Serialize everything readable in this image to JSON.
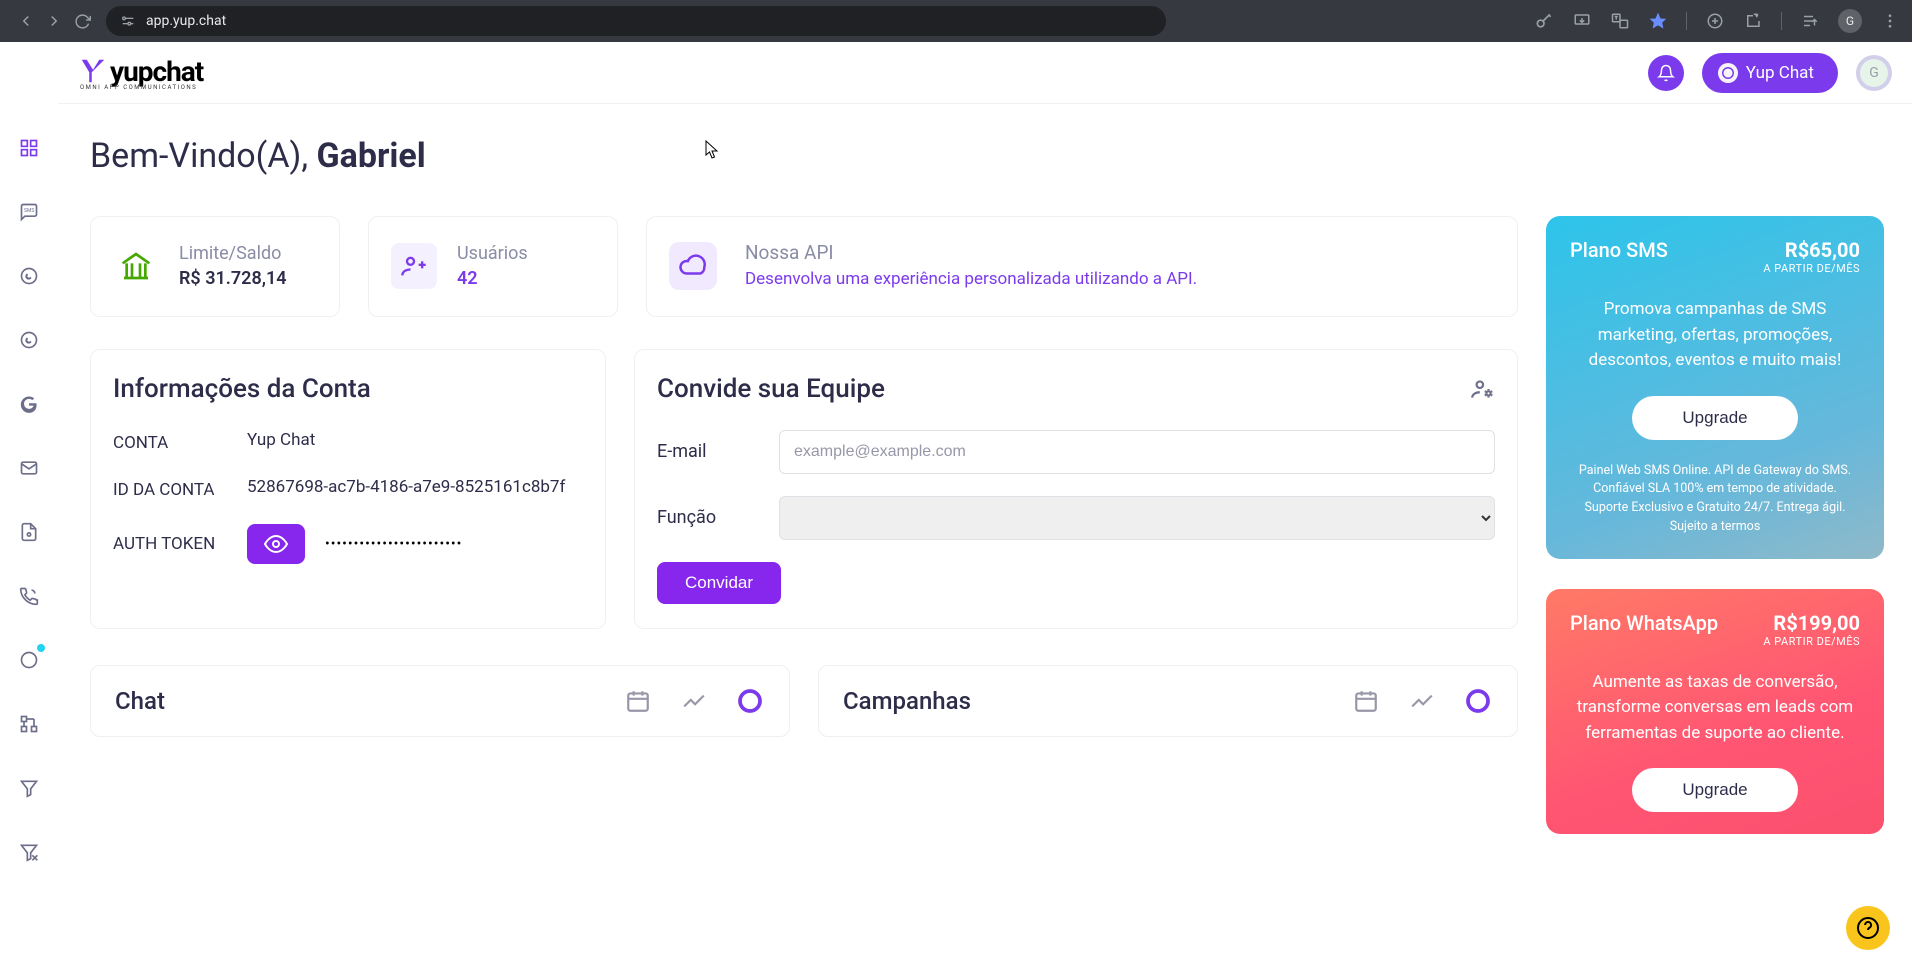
{
  "browser": {
    "url": "app.yup.chat",
    "avatar_letter": "G"
  },
  "topbar": {
    "brand": "yupchat",
    "brand_sub": "OMNI APP COMMUNICATIONS",
    "pill_label": "Yup Chat",
    "avatar_letter": "G"
  },
  "welcome": {
    "prefix": "Bem-Vindo(A), ",
    "name": "Gabriel"
  },
  "stats": {
    "balance": {
      "label": "Limite/Saldo",
      "value": "R$ 31.728,14"
    },
    "users": {
      "label": "Usuários",
      "value": "42"
    }
  },
  "api": {
    "title": "Nossa API",
    "desc": "Desenvolva uma experiência personalizada utilizando a API."
  },
  "account": {
    "title": "Informações da Conta",
    "rows": {
      "conta": {
        "k": "CONTA",
        "v": "Yup Chat"
      },
      "id": {
        "k": "ID DA CONTA",
        "v": "52867698-ac7b-4186-a7e9-8525161c8b7f"
      },
      "token": {
        "k": "AUTH TOKEN",
        "v": "••••••••••••••••••••••••"
      }
    }
  },
  "invite": {
    "title": "Convide sua Equipe",
    "email_label": "E-mail",
    "email_placeholder": "example@example.com",
    "role_label": "Função",
    "button": "Convidar"
  },
  "promos": {
    "sms": {
      "name": "Plano SMS",
      "price": "R$65,00",
      "price_sub": "A PARTIR DE/MÊS",
      "body": "Promova campanhas de SMS marketing, ofertas, promoções, descontos, eventos e muito mais!",
      "button": "Upgrade",
      "footer": "Painel Web SMS Online. API de Gateway do SMS. Confiável SLA 100% em tempo de atividade. Suporte Exclusivo e Gratuito 24/7. Entrega ágil. Sujeito a termos"
    },
    "whatsapp": {
      "name": "Plano WhatsApp",
      "price": "R$199,00",
      "price_sub": "A PARTIR DE/MÊS",
      "body": "Aumente as taxas de conversão, transforme conversas em leads com ferramentas de suporte ao cliente.",
      "button": "Upgrade"
    }
  },
  "charts": {
    "chat": "Chat",
    "campaigns": "Campanhas"
  }
}
